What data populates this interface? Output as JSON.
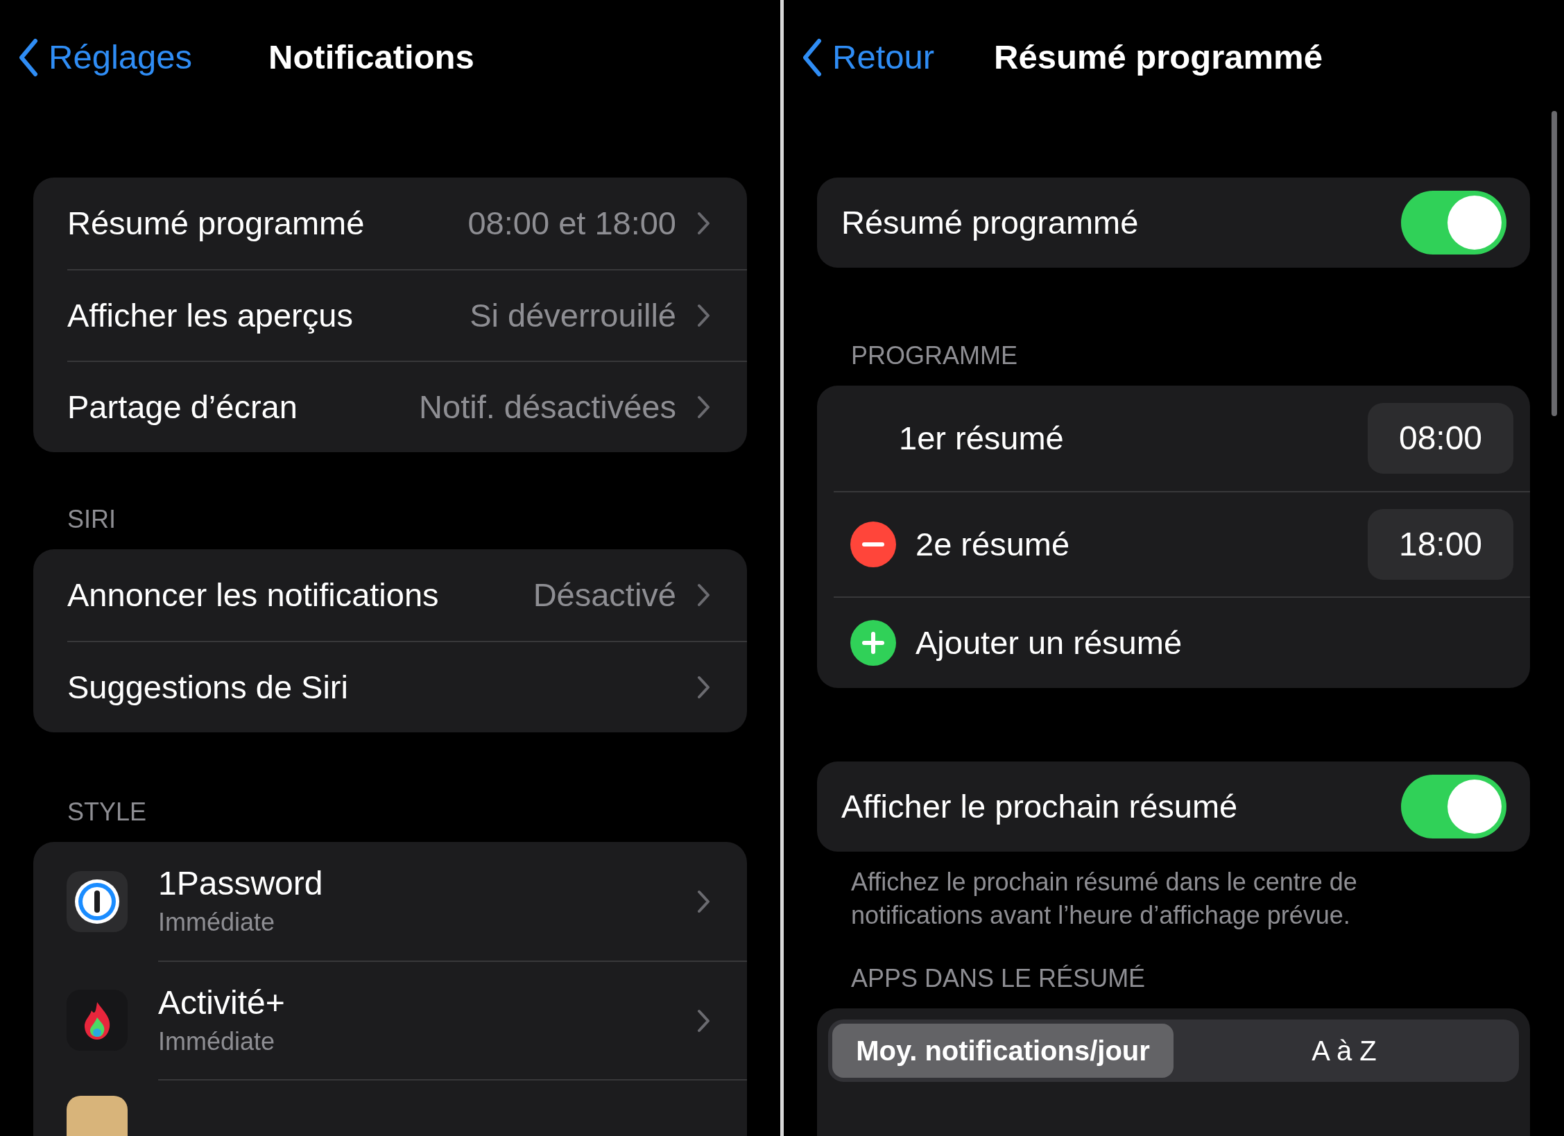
{
  "left": {
    "back": "Réglages",
    "title": "Notifications",
    "groups": [
      {
        "rows": [
          {
            "label": "Résumé programmé",
            "value": "08:00 et 18:00"
          },
          {
            "label": "Afficher les aperçus",
            "value": "Si déverrouillé"
          },
          {
            "label": "Partage d’écran",
            "value": "Notif. désactivées"
          }
        ]
      },
      {
        "header": "SIRI",
        "rows": [
          {
            "label": "Annoncer les notifications",
            "value": "Désactivé"
          },
          {
            "label": "Suggestions de Siri"
          }
        ]
      }
    ],
    "style": {
      "header": "STYLE",
      "apps": [
        {
          "kind": "password",
          "name": "1Password",
          "subtitle": "Immédiate"
        },
        {
          "kind": "flame",
          "name": "Activité+",
          "subtitle": "Immédiate"
        },
        {
          "kind": "box"
        }
      ]
    }
  },
  "right": {
    "back": "Retour",
    "title": "Résumé programmé",
    "main_toggle": {
      "label": "Résumé programmé",
      "on": true
    },
    "schedule": {
      "header": "PROGRAMME",
      "rows": [
        {
          "kind": "plain",
          "label": "1er résumé",
          "time": "08:00"
        },
        {
          "kind": "remove",
          "label": "2e résumé",
          "time": "18:00"
        },
        {
          "kind": "add",
          "label": "Ajouter un résumé"
        }
      ]
    },
    "next_toggle": {
      "label": "Afficher le prochain résumé",
      "on": true
    },
    "footer": "Affichez le prochain résumé dans le centre de notifications avant l’heure d’affichage prévue.",
    "apps": {
      "header": "APPS DANS LE RÉSUMÉ",
      "segments": [
        {
          "label": "Moy. notifications/jour",
          "selected": true
        },
        {
          "label": "A à Z",
          "selected": false
        }
      ]
    }
  }
}
